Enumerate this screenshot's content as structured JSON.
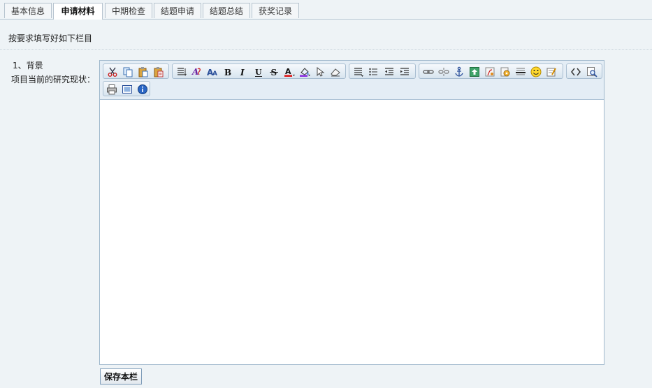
{
  "tabs": [
    "基本信息",
    "申请材料",
    "中期检查",
    "结题申请",
    "结题总结",
    "获奖记录"
  ],
  "active_tab": "申请材料",
  "instruction": "按要求填写好如下栏目",
  "section": {
    "title": "1、背景",
    "label": "项目当前的研究现状："
  },
  "editor": {
    "content": "",
    "toolbar_groups": [
      [
        "cut-icon",
        "copy-icon",
        "paste-icon",
        "paste-text-icon"
      ],
      [
        "paragraph-format-icon",
        "font-family-icon",
        "font-size-icon",
        "bold-icon",
        "italic-icon",
        "underline-icon",
        "strikethrough-icon",
        "text-color-icon",
        "highlight-color-icon",
        "select-all-icon",
        "remove-format-icon"
      ],
      [
        "align-icon",
        "unordered-list-icon",
        "outdent-icon",
        "indent-icon"
      ],
      [
        "link-icon",
        "unlink-icon",
        "anchor-icon",
        "image-upload-icon",
        "flash-icon",
        "media-icon",
        "horizontal-rule-icon",
        "emoticon-icon",
        "special-char-icon"
      ],
      [
        "source-code-icon",
        "preview-icon"
      ],
      [
        "print-icon",
        "fullscreen-icon",
        "about-icon"
      ]
    ],
    "glyphs": {
      "bold-icon": "B",
      "italic-icon": "I",
      "underline-icon": "U",
      "strikethrough-icon": "S",
      "text-color-icon": "A",
      "font-size-icon": "A"
    }
  },
  "save_button": "保存本栏",
  "colors": {
    "background": "#eef3f6",
    "toolbar": "#e4edf5",
    "border": "#9fb8cc"
  }
}
